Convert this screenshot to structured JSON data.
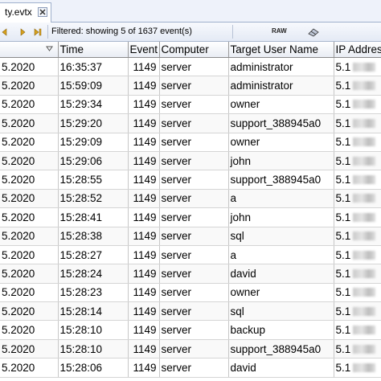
{
  "tab": {
    "label": "ty.evtx"
  },
  "toolbar": {
    "filter_status": "Filtered: showing 5 of 1637 event(s)",
    "raw_label": "RAW"
  },
  "columns": [
    "",
    "Time",
    "Event",
    "Computer",
    "Target User Name",
    "IP Addres"
  ],
  "rows": [
    {
      "date": "5.2020",
      "time": "16:35:37",
      "event": "1149",
      "computer": "server",
      "user": "administrator",
      "ip": "5.1"
    },
    {
      "date": "5.2020",
      "time": "15:59:09",
      "event": "1149",
      "computer": "server",
      "user": "administrator",
      "ip": "5.1"
    },
    {
      "date": "5.2020",
      "time": "15:29:34",
      "event": "1149",
      "computer": "server",
      "user": "owner",
      "ip": "5.1"
    },
    {
      "date": "5.2020",
      "time": "15:29:20",
      "event": "1149",
      "computer": "server",
      "user": "support_388945a0",
      "ip": "5.1"
    },
    {
      "date": "5.2020",
      "time": "15:29:09",
      "event": "1149",
      "computer": "server",
      "user": "owner",
      "ip": "5.1"
    },
    {
      "date": "5.2020",
      "time": "15:29:06",
      "event": "1149",
      "computer": "server",
      "user": "john",
      "ip": "5.1"
    },
    {
      "date": "5.2020",
      "time": "15:28:55",
      "event": "1149",
      "computer": "server",
      "user": "support_388945a0",
      "ip": "5.1"
    },
    {
      "date": "5.2020",
      "time": "15:28:52",
      "event": "1149",
      "computer": "server",
      "user": "a",
      "ip": "5.1"
    },
    {
      "date": "5.2020",
      "time": "15:28:41",
      "event": "1149",
      "computer": "server",
      "user": "john",
      "ip": "5.1"
    },
    {
      "date": "5.2020",
      "time": "15:28:38",
      "event": "1149",
      "computer": "server",
      "user": "sql",
      "ip": "5.1"
    },
    {
      "date": "5.2020",
      "time": "15:28:27",
      "event": "1149",
      "computer": "server",
      "user": "a",
      "ip": "5.1"
    },
    {
      "date": "5.2020",
      "time": "15:28:24",
      "event": "1149",
      "computer": "server",
      "user": "david",
      "ip": "5.1"
    },
    {
      "date": "5.2020",
      "time": "15:28:23",
      "event": "1149",
      "computer": "server",
      "user": "owner",
      "ip": "5.1"
    },
    {
      "date": "5.2020",
      "time": "15:28:14",
      "event": "1149",
      "computer": "server",
      "user": "sql",
      "ip": "5.1"
    },
    {
      "date": "5.2020",
      "time": "15:28:10",
      "event": "1149",
      "computer": "server",
      "user": "backup",
      "ip": "5.1"
    },
    {
      "date": "5.2020",
      "time": "15:28:10",
      "event": "1149",
      "computer": "server",
      "user": "support_388945a0",
      "ip": "5.1"
    },
    {
      "date": "5.2020",
      "time": "15:28:06",
      "event": "1149",
      "computer": "server",
      "user": "david",
      "ip": "5.1"
    }
  ],
  "colors": {
    "accent": "#3a62b8",
    "header_bg": "#e9edf4",
    "toolbar_bg": "#e4eaf5"
  },
  "icons": [
    "close-icon",
    "nav-first-icon",
    "nav-prev-icon",
    "nav-next-icon",
    "nav-last-icon",
    "eraser-icon",
    "sort-desc-icon"
  ]
}
